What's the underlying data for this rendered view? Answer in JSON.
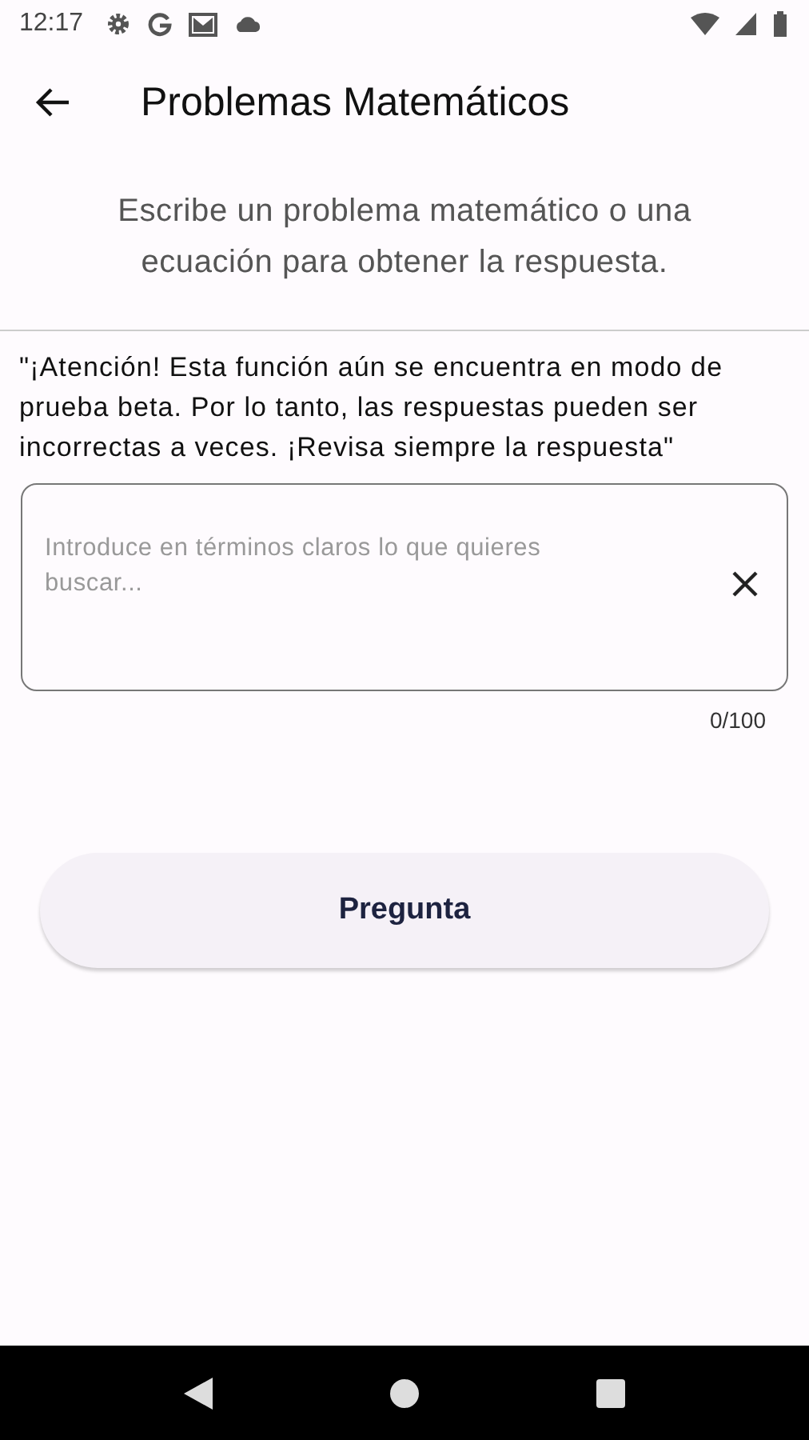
{
  "status_bar": {
    "time": "12:17"
  },
  "app_bar": {
    "title": "Problemas Matemáticos"
  },
  "subtitle": "Escribe un problema matemático o una ecuación para obtener la respuesta.",
  "warning": "\"¡Atención! Esta función aún se encuentra en modo de prueba beta. Por lo tanto, las respuestas pueden ser incorrectas a veces. ¡Revisa siempre la respuesta\"",
  "query_field": {
    "placeholder": "Introduce en términos claros lo que quieres buscar...",
    "counter": "0/100"
  },
  "submit_button": {
    "label": "Pregunta"
  }
}
